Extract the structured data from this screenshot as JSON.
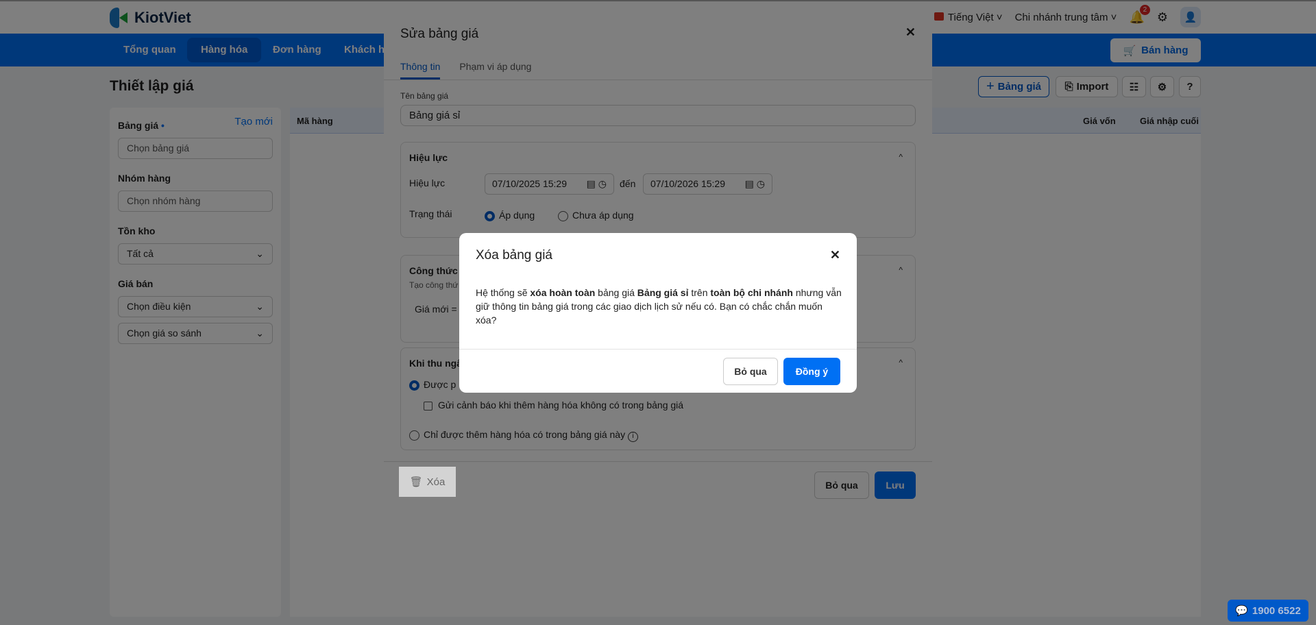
{
  "app": {
    "brand": "KiotViet",
    "language": "Tiếng Việt",
    "branch": "Chi nhánh trung tâm",
    "notifications": "2",
    "sell_button": "Bán hàng",
    "hotline": "1900 6522"
  },
  "nav": {
    "tabs": [
      {
        "label": "Tổng quan"
      },
      {
        "label": "Hàng hóa",
        "active": true
      },
      {
        "label": "Đơn hàng"
      },
      {
        "label": "Khách hàng"
      }
    ]
  },
  "page": {
    "title": "Thiết lập giá",
    "actions": {
      "add_price_list": "Bảng giá",
      "import": "Import"
    }
  },
  "filters": {
    "price_list_label": "Bảng giá",
    "create_new": "Tạo mới",
    "price_list_placeholder": "Chọn bảng giá",
    "group_label": "Nhóm hàng",
    "group_placeholder": "Chọn nhóm hàng",
    "stock_label": "Tồn kho",
    "stock_value": "Tất cả",
    "sell_price_label": "Giá bán",
    "condition_value": "Chọn điều kiện",
    "compare_value": "Chọn giá so sánh"
  },
  "table": {
    "columns": [
      "Mã hàng",
      "Giá vốn",
      "Giá nhập cuối"
    ]
  },
  "edit_modal": {
    "title": "Sửa bảng giá",
    "tabs": [
      "Thông tin",
      "Phạm vi áp dụng"
    ],
    "name_label": "Tên bảng giá",
    "name_value": "Bảng giá sỉ",
    "validity": {
      "title": "Hiệu lực",
      "label": "Hiệu lực",
      "from": "07/10/2025 15:29",
      "to_label": "đến",
      "to": "07/10/2026 15:29",
      "status_label": "Trạng thái",
      "status_options": [
        "Áp dụng",
        "Chưa áp dụng"
      ],
      "status_selected": "Áp dụng"
    },
    "formula": {
      "title": "Công thức",
      "subtitle": "Tạo công thứ",
      "new_price": "Giá mới ="
    },
    "cashier": {
      "title": "Khi thu ngâ",
      "option1": "Được p",
      "warn_checkbox": "Gửi cảnh báo khi thêm hàng hóa không có trong bảng giá",
      "option2": "Chỉ được thêm hàng hóa có trong bảng giá này"
    },
    "delete": "Xóa",
    "cancel": "Bỏ qua",
    "save": "Lưu"
  },
  "delete_dialog": {
    "title": "Xóa bảng giá",
    "body": [
      {
        "t": "Hệ thống sẽ ",
        "b": false
      },
      {
        "t": "xóa hoàn toàn",
        "b": true
      },
      {
        "t": " bảng giá ",
        "b": false
      },
      {
        "t": "Bảng giá sỉ",
        "b": true
      },
      {
        "t": " trên ",
        "b": false
      },
      {
        "t": "toàn bộ chi nhánh",
        "b": true
      },
      {
        "t": " nhưng vẫn giữ thông tin bảng giá trong các giao dịch lịch sử nếu có. Bạn có chắc chắn muốn xóa?",
        "b": false
      }
    ],
    "cancel": "Bỏ qua",
    "confirm": "Đồng ý"
  },
  "colors": {
    "primary": "#0070f4",
    "confirm": "#0070f4"
  }
}
